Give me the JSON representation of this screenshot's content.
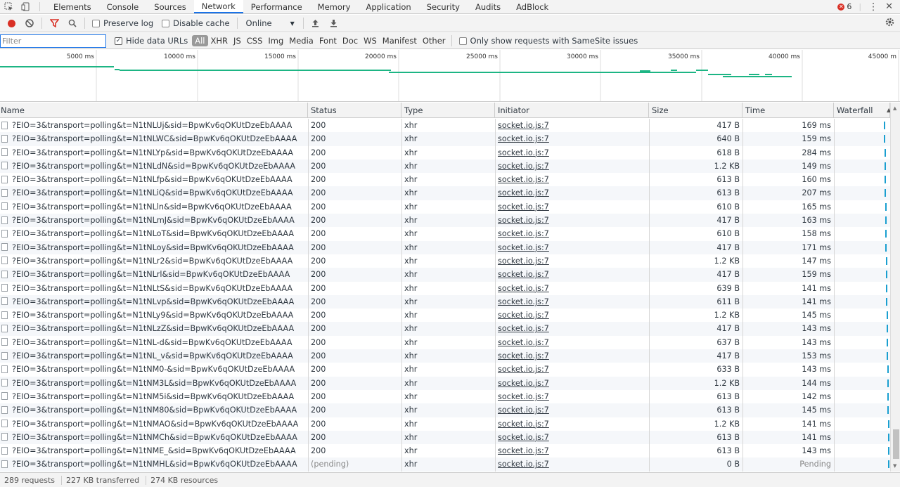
{
  "tabs": [
    "Elements",
    "Console",
    "Sources",
    "Network",
    "Performance",
    "Memory",
    "Application",
    "Security",
    "Audits",
    "AdBlock"
  ],
  "active_tab": "Network",
  "error_count": "6",
  "toolbar": {
    "preserve_log": "Preserve log",
    "disable_cache": "Disable cache",
    "throttle": "Online"
  },
  "filterbar": {
    "placeholder": "Filter",
    "hide_data_urls": "Hide data URLs",
    "types": [
      "All",
      "XHR",
      "JS",
      "CSS",
      "Img",
      "Media",
      "Font",
      "Doc",
      "WS",
      "Manifest",
      "Other"
    ],
    "samesite": "Only show requests with SameSite issues"
  },
  "timeline_ticks": [
    "5000 ms",
    "10000 ms",
    "15000 ms",
    "20000 ms",
    "25000 ms",
    "30000 ms",
    "35000 ms",
    "40000 ms",
    "45000 m"
  ],
  "columns": [
    "Name",
    "Status",
    "Type",
    "Initiator",
    "Size",
    "Time",
    "Waterfall"
  ],
  "rows": [
    {
      "name": "?EIO=3&transport=polling&t=N1tNLUj&sid=BpwKv6qOKUtDzeEbAAAA",
      "status": "200",
      "type": "xhr",
      "initiator": "socket.io.js:7",
      "size": "417 B",
      "time": "169 ms"
    },
    {
      "name": "?EIO=3&transport=polling&t=N1tNLWC&sid=BpwKv6qOKUtDzeEbAAAA",
      "status": "200",
      "type": "xhr",
      "initiator": "socket.io.js:7",
      "size": "640 B",
      "time": "159 ms"
    },
    {
      "name": "?EIO=3&transport=polling&t=N1tNLYp&sid=BpwKv6qOKUtDzeEbAAAA",
      "status": "200",
      "type": "xhr",
      "initiator": "socket.io.js:7",
      "size": "618 B",
      "time": "284 ms"
    },
    {
      "name": "?EIO=3&transport=polling&t=N1tNLdN&sid=BpwKv6qOKUtDzeEbAAAA",
      "status": "200",
      "type": "xhr",
      "initiator": "socket.io.js:7",
      "size": "1.2 KB",
      "time": "149 ms"
    },
    {
      "name": "?EIO=3&transport=polling&t=N1tNLfp&sid=BpwKv6qOKUtDzeEbAAAA",
      "status": "200",
      "type": "xhr",
      "initiator": "socket.io.js:7",
      "size": "613 B",
      "time": "160 ms"
    },
    {
      "name": "?EIO=3&transport=polling&t=N1tNLiQ&sid=BpwKv6qOKUtDzeEbAAAA",
      "status": "200",
      "type": "xhr",
      "initiator": "socket.io.js:7",
      "size": "613 B",
      "time": "207 ms"
    },
    {
      "name": "?EIO=3&transport=polling&t=N1tNLln&sid=BpwKv6qOKUtDzeEbAAAA",
      "status": "200",
      "type": "xhr",
      "initiator": "socket.io.js:7",
      "size": "610 B",
      "time": "165 ms"
    },
    {
      "name": "?EIO=3&transport=polling&t=N1tNLmJ&sid=BpwKv6qOKUtDzeEbAAAA",
      "status": "200",
      "type": "xhr",
      "initiator": "socket.io.js:7",
      "size": "417 B",
      "time": "163 ms"
    },
    {
      "name": "?EIO=3&transport=polling&t=N1tNLoT&sid=BpwKv6qOKUtDzeEbAAAA",
      "status": "200",
      "type": "xhr",
      "initiator": "socket.io.js:7",
      "size": "610 B",
      "time": "158 ms"
    },
    {
      "name": "?EIO=3&transport=polling&t=N1tNLoy&sid=BpwKv6qOKUtDzeEbAAAA",
      "status": "200",
      "type": "xhr",
      "initiator": "socket.io.js:7",
      "size": "417 B",
      "time": "171 ms"
    },
    {
      "name": "?EIO=3&transport=polling&t=N1tNLr2&sid=BpwKv6qOKUtDzeEbAAAA",
      "status": "200",
      "type": "xhr",
      "initiator": "socket.io.js:7",
      "size": "1.2 KB",
      "time": "147 ms"
    },
    {
      "name": "?EIO=3&transport=polling&t=N1tNLrl&sid=BpwKv6qOKUtDzeEbAAAA",
      "status": "200",
      "type": "xhr",
      "initiator": "socket.io.js:7",
      "size": "417 B",
      "time": "159 ms"
    },
    {
      "name": "?EIO=3&transport=polling&t=N1tNLtS&sid=BpwKv6qOKUtDzeEbAAAA",
      "status": "200",
      "type": "xhr",
      "initiator": "socket.io.js:7",
      "size": "639 B",
      "time": "141 ms"
    },
    {
      "name": "?EIO=3&transport=polling&t=N1tNLvp&sid=BpwKv6qOKUtDzeEbAAAA",
      "status": "200",
      "type": "xhr",
      "initiator": "socket.io.js:7",
      "size": "611 B",
      "time": "141 ms"
    },
    {
      "name": "?EIO=3&transport=polling&t=N1tNLy9&sid=BpwKv6qOKUtDzeEbAAAA",
      "status": "200",
      "type": "xhr",
      "initiator": "socket.io.js:7",
      "size": "1.2 KB",
      "time": "145 ms"
    },
    {
      "name": "?EIO=3&transport=polling&t=N1tNLzZ&sid=BpwKv6qOKUtDzeEbAAAA",
      "status": "200",
      "type": "xhr",
      "initiator": "socket.io.js:7",
      "size": "417 B",
      "time": "143 ms"
    },
    {
      "name": "?EIO=3&transport=polling&t=N1tNL-d&sid=BpwKv6qOKUtDzeEbAAAA",
      "status": "200",
      "type": "xhr",
      "initiator": "socket.io.js:7",
      "size": "637 B",
      "time": "143 ms"
    },
    {
      "name": "?EIO=3&transport=polling&t=N1tNL_v&sid=BpwKv6qOKUtDzeEbAAAA",
      "status": "200",
      "type": "xhr",
      "initiator": "socket.io.js:7",
      "size": "417 B",
      "time": "153 ms"
    },
    {
      "name": "?EIO=3&transport=polling&t=N1tNM0-&sid=BpwKv6qOKUtDzeEbAAAA",
      "status": "200",
      "type": "xhr",
      "initiator": "socket.io.js:7",
      "size": "633 B",
      "time": "143 ms"
    },
    {
      "name": "?EIO=3&transport=polling&t=N1tNM3L&sid=BpwKv6qOKUtDzeEbAAAA",
      "status": "200",
      "type": "xhr",
      "initiator": "socket.io.js:7",
      "size": "1.2 KB",
      "time": "144 ms"
    },
    {
      "name": "?EIO=3&transport=polling&t=N1tNM5i&sid=BpwKv6qOKUtDzeEbAAAA",
      "status": "200",
      "type": "xhr",
      "initiator": "socket.io.js:7",
      "size": "613 B",
      "time": "142 ms"
    },
    {
      "name": "?EIO=3&transport=polling&t=N1tNM80&sid=BpwKv6qOKUtDzeEbAAAA",
      "status": "200",
      "type": "xhr",
      "initiator": "socket.io.js:7",
      "size": "613 B",
      "time": "145 ms"
    },
    {
      "name": "?EIO=3&transport=polling&t=N1tNMAO&sid=BpwKv6qOKUtDzeEbAAAA",
      "status": "200",
      "type": "xhr",
      "initiator": "socket.io.js:7",
      "size": "1.2 KB",
      "time": "141 ms"
    },
    {
      "name": "?EIO=3&transport=polling&t=N1tNMCh&sid=BpwKv6qOKUtDzeEbAAAA",
      "status": "200",
      "type": "xhr",
      "initiator": "socket.io.js:7",
      "size": "613 B",
      "time": "141 ms"
    },
    {
      "name": "?EIO=3&transport=polling&t=N1tNME_&sid=BpwKv6qOKUtDzeEbAAAA",
      "status": "200",
      "type": "xhr",
      "initiator": "socket.io.js:7",
      "size": "613 B",
      "time": "143 ms"
    },
    {
      "name": "?EIO=3&transport=polling&t=N1tNMHL&sid=BpwKv6qOKUtDzeEbAAAA",
      "status": "(pending)",
      "type": "xhr",
      "initiator": "socket.io.js:7",
      "size": "0 B",
      "time": "Pending"
    }
  ],
  "status": {
    "requests": "289 requests",
    "transferred": "227 KB transferred",
    "resources": "274 KB resources"
  },
  "colors": {
    "accent": "#1a73e8",
    "record": "#d93025",
    "timeline": "#1db584",
    "waterfall": "#1a9fd0"
  }
}
